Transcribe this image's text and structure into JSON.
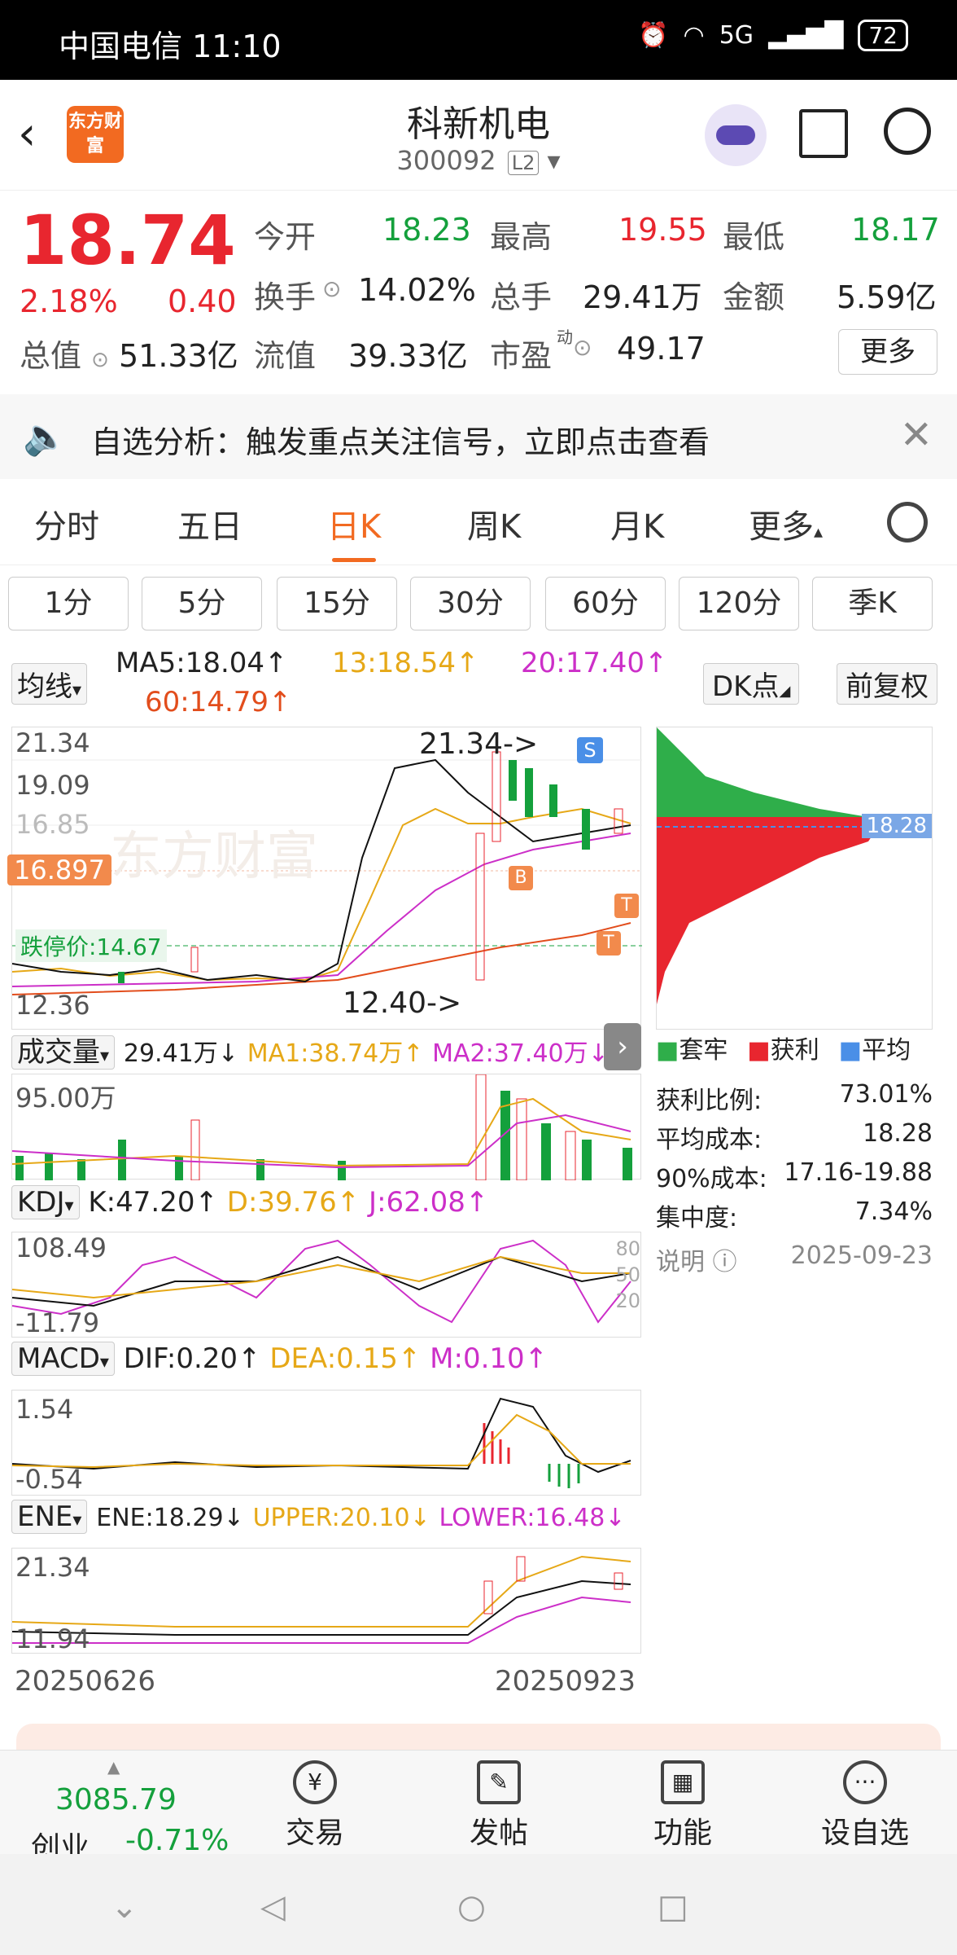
{
  "status_bar": {
    "carrier_time": "中国电信 11:10",
    "network": "5G",
    "battery": "72"
  },
  "header": {
    "logo_text": "东方财富",
    "stock_name": "科新机电",
    "stock_code": "300092",
    "level": "L2"
  },
  "quote": {
    "price": "18.74",
    "pct": "2.18%",
    "change": "0.40",
    "open_label": "今开",
    "open": "18.23",
    "high_label": "最高",
    "high": "19.55",
    "low_label": "最低",
    "low": "18.17",
    "turnover_label": "换手",
    "turnover": "14.02%",
    "volume_label": "总手",
    "volume": "29.41万",
    "amount_label": "金额",
    "amount": "5.59亿",
    "mktcap_label": "总值",
    "mktcap": "51.33亿",
    "float_label": "流值",
    "float": "39.33亿",
    "pe_label": "市盈",
    "pe_sup": "动",
    "pe": "49.17",
    "more": "更多"
  },
  "notice": {
    "text": "自选分析：触发重点关注信号，立即点击查看"
  },
  "tabs": [
    "分时",
    "五日",
    "日K",
    "周K",
    "月K",
    "更多"
  ],
  "periods": [
    "1分",
    "5分",
    "15分",
    "30分",
    "60分",
    "120分",
    "季K"
  ],
  "ma": {
    "selector": "均线",
    "ma5": "MA5:18.04↑",
    "ma13": "13:18.54↑",
    "ma20": "20:17.40↑",
    "ma60": "60:14.79↑",
    "dk": "DK点",
    "adjust": "前复权"
  },
  "kchart": {
    "y_top": "21.34",
    "y_mid": "19.09",
    "y_low": "16.85",
    "y_bottom": "12.36",
    "cursor": "16.897",
    "limit_down": "跌停价:14.67",
    "high_mark": "21.34->",
    "low_mark": "12.40->",
    "watermark": "东方财富"
  },
  "cost": {
    "avg": "18.28",
    "legend": [
      "套牢",
      "获利",
      "平均"
    ],
    "rows": [
      {
        "label": "获利比例:",
        "value": "73.01%"
      },
      {
        "label": "平均成本:",
        "value": "18.28"
      },
      {
        "label": "90%成本:",
        "value": "17.16-19.88"
      },
      {
        "label": "集中度:",
        "value": "7.34%"
      }
    ],
    "note": "说明",
    "date": "2025-09-23"
  },
  "volume": {
    "selector": "成交量",
    "value": "29.41万↓",
    "ma1": "MA1:38.74万↑",
    "ma2": "MA2:37.40万↓",
    "y_top": "95.00万"
  },
  "kdj": {
    "selector": "KDJ",
    "k": "K:47.20↑",
    "d": "D:39.76↑",
    "j": "J:62.08↑",
    "y_top": "108.49",
    "y_bottom": "-11.79",
    "r80": "80",
    "r50": "50",
    "r20": "20"
  },
  "macd": {
    "selector": "MACD",
    "dif": "DIF:0.20↑",
    "dea": "DEA:0.15↑",
    "m": "M:0.10↑",
    "y_top": "1.54",
    "y_bottom": "-0.54"
  },
  "ene": {
    "selector": "ENE",
    "ene": "ENE:18.29↓",
    "upper": "UPPER:20.10↓",
    "lower": "LOWER:16.48↓",
    "y_top": "21.34",
    "y_bottom": "11.94"
  },
  "dates": {
    "start": "20250626",
    "end": "20250923"
  },
  "bottom": {
    "index_value": "3085.79",
    "index_name": "创业",
    "index_pct": "-0.71%",
    "items": [
      "交易",
      "发帖",
      "功能",
      "设自选"
    ]
  }
}
